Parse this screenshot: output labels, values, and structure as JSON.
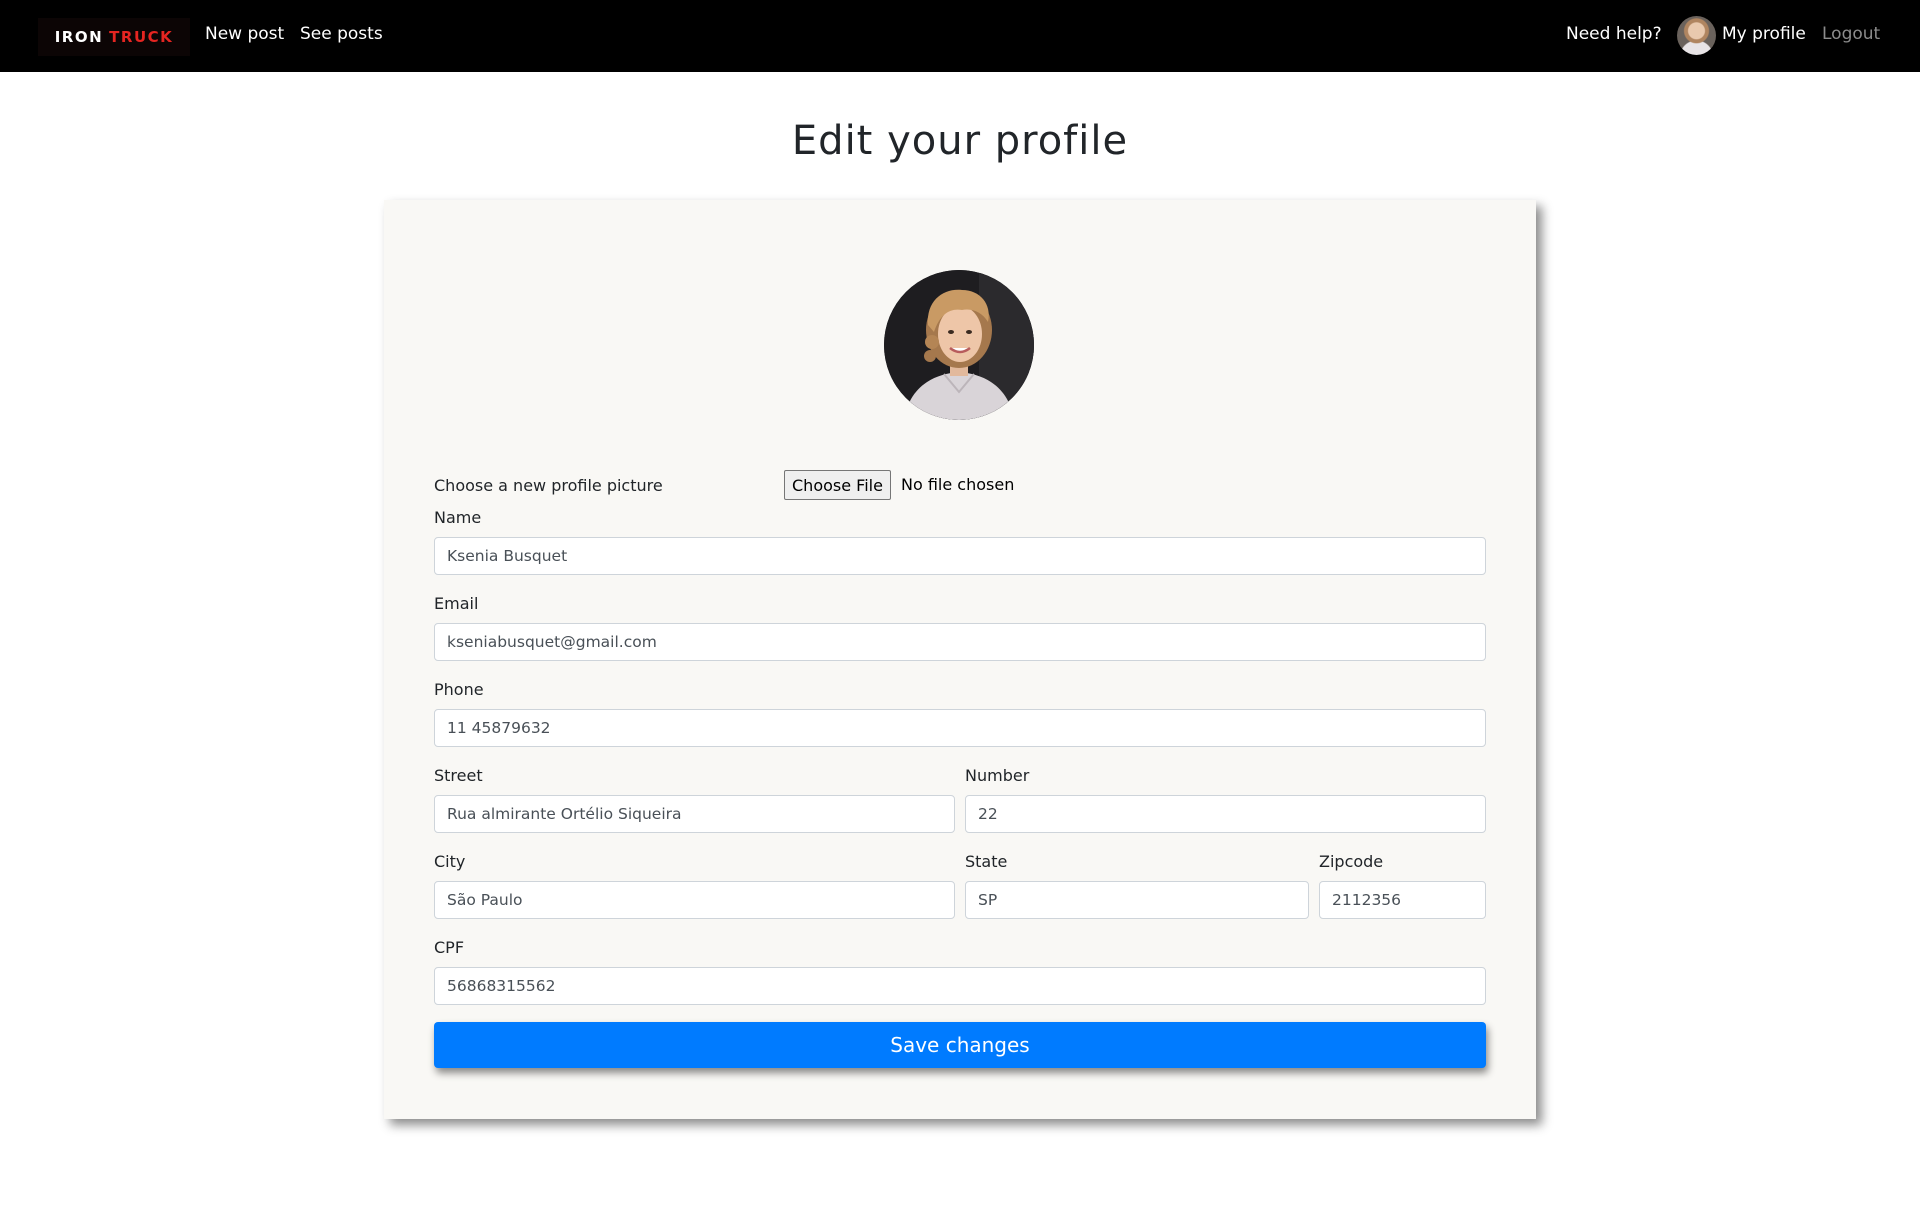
{
  "navbar": {
    "brand_part1": "IRON",
    "brand_part2": "TRUCK",
    "new_post": "New post",
    "see_posts": "See posts",
    "need_help": "Need help?",
    "my_profile": "My profile",
    "logout": "Logout"
  },
  "page": {
    "title": "Edit your profile"
  },
  "form": {
    "picture_label": "Choose a new profile picture",
    "file_button": "Choose File",
    "file_status": "No file chosen",
    "name_label": "Name",
    "name_value": "Ksenia Busquet",
    "email_label": "Email",
    "email_value": "kseniabusquet@gmail.com",
    "phone_label": "Phone",
    "phone_value": "11 45879632",
    "street_label": "Street",
    "street_value": "Rua almirante Ortélio Siqueira",
    "number_label": "Number",
    "number_value": "22",
    "city_label": "City",
    "city_value": "São Paulo",
    "state_label": "State",
    "state_value": "SP",
    "zipcode_label": "Zipcode",
    "zipcode_value": "2112356",
    "cpf_label": "CPF",
    "cpf_value": "56868315562",
    "save_button": "Save changes"
  },
  "colors": {
    "navbar_bg": "#000000",
    "brand_accent": "#e52521",
    "primary_button": "#007bff",
    "card_bg": "#f9f8f5",
    "logout_text": "#8c8c8c"
  },
  "icons": {
    "nav_avatar": "user-avatar-photo",
    "profile_photo": "profile-photo"
  }
}
